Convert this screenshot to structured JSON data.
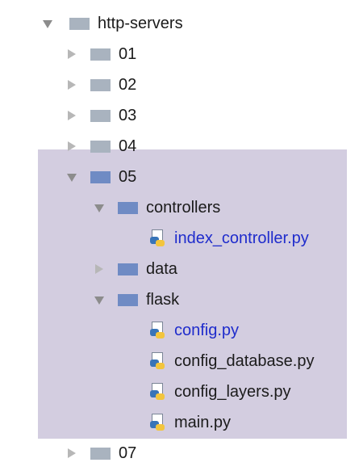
{
  "tree": {
    "root": {
      "label": "http-servers",
      "expanded": true,
      "icon": "folder-icon"
    },
    "items": [
      {
        "name": "folder-01",
        "label": "01",
        "type": "folder",
        "expanded": false,
        "folder_color": "#a9b3bf"
      },
      {
        "name": "folder-02",
        "label": "02",
        "type": "folder",
        "expanded": false,
        "folder_color": "#a9b3bf"
      },
      {
        "name": "folder-03",
        "label": "03",
        "type": "folder",
        "expanded": false,
        "folder_color": "#a9b3bf"
      },
      {
        "name": "folder-04",
        "label": "04",
        "type": "folder",
        "expanded": false,
        "folder_color": "#a9b3bf"
      },
      {
        "name": "folder-05",
        "label": "05",
        "type": "folder",
        "expanded": true,
        "folder_color": "#6f8bc4"
      },
      {
        "name": "folder-controllers",
        "label": "controllers",
        "type": "folder",
        "expanded": true,
        "folder_color": "#6f8bc4"
      },
      {
        "name": "file-index-controller",
        "label": "index_controller.py",
        "type": "file",
        "icon": "python-file-icon"
      },
      {
        "name": "folder-data",
        "label": "data",
        "type": "folder",
        "expanded": false,
        "folder_color": "#6f8bc4"
      },
      {
        "name": "folder-flask",
        "label": "flask",
        "type": "folder",
        "expanded": true,
        "folder_color": "#6f8bc4"
      },
      {
        "name": "file-config",
        "label": "config.py",
        "type": "file",
        "icon": "python-file-icon"
      },
      {
        "name": "file-config-database",
        "label": "config_database.py",
        "type": "file",
        "icon": "python-file-icon"
      },
      {
        "name": "file-config-layers",
        "label": "config_layers.py",
        "type": "file",
        "icon": "python-file-icon"
      },
      {
        "name": "file-main",
        "label": "main.py",
        "type": "file",
        "icon": "python-file-icon"
      },
      {
        "name": "folder-07",
        "label": "07",
        "type": "folder",
        "expanded": false,
        "folder_color": "#a9b3bf"
      }
    ]
  },
  "colors": {
    "selection_highlight": "#d3cde0",
    "file_text": "#1f2ccc",
    "folder_text": "#1b1b1b"
  }
}
